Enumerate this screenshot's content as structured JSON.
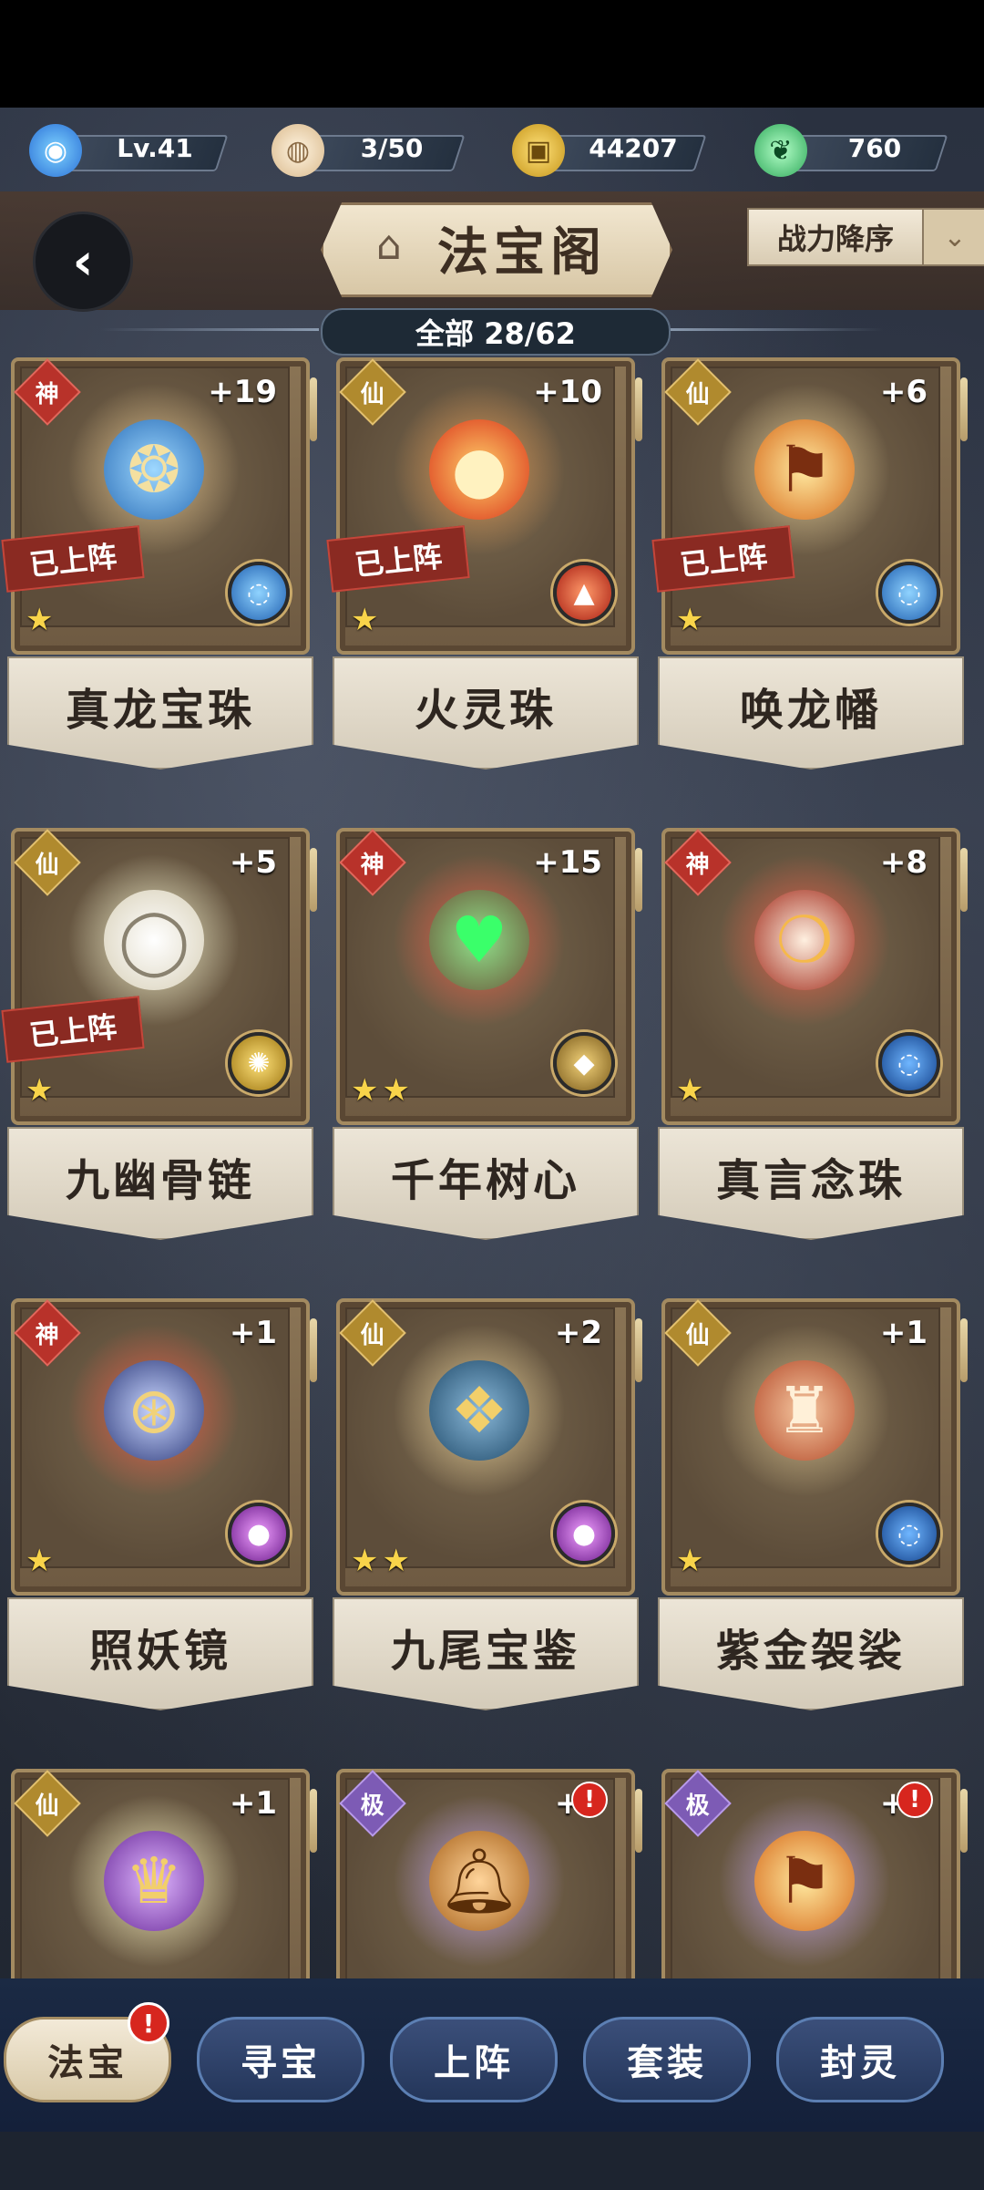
{
  "resources": {
    "level": "Lv.41",
    "stamina": "3/50",
    "coins": "44207",
    "jade": "760"
  },
  "header": {
    "title": "法宝阁",
    "sort_label": "战力降序",
    "count_label": "全部 28/62"
  },
  "cards": [
    {
      "grade": "神",
      "level": "+19",
      "name": "真龙宝珠",
      "deployed": "已上阵",
      "stars": "★"
    },
    {
      "grade": "仙",
      "level": "+10",
      "name": "火灵珠",
      "deployed": "已上阵",
      "stars": "★"
    },
    {
      "grade": "仙",
      "level": "+6",
      "name": "唤龙幡",
      "deployed": "已上阵",
      "stars": "★"
    },
    {
      "grade": "仙",
      "level": "+5",
      "name": "九幽骨链",
      "deployed": "已上阵",
      "stars": "★"
    },
    {
      "grade": "神",
      "level": "+15",
      "name": "千年树心",
      "stars": "★★"
    },
    {
      "grade": "神",
      "level": "+8",
      "name": "真言念珠",
      "stars": "★"
    },
    {
      "grade": "神",
      "level": "+1",
      "name": "照妖镜",
      "stars": "★"
    },
    {
      "grade": "仙",
      "level": "+2",
      "name": "九尾宝鉴",
      "stars": "★★"
    },
    {
      "grade": "仙",
      "level": "+1",
      "name": "紫金袈裟",
      "stars": "★"
    },
    {
      "grade": "仙",
      "level": "+1"
    },
    {
      "grade": "极",
      "level": "+3",
      "badge": "!"
    },
    {
      "grade": "极",
      "level": "+3",
      "badge": "!"
    }
  ],
  "tabs": [
    {
      "label": "法宝",
      "badge": "!"
    },
    {
      "label": "寻宝"
    },
    {
      "label": "上阵"
    },
    {
      "label": "套装"
    },
    {
      "label": "封灵"
    }
  ],
  "colors": {
    "grade_shen": "#c0392b",
    "grade_xian": "#b08a2e",
    "grade_ji": "#7d5bb5",
    "deployed_tag": "#8a2a22",
    "star": "#f8d44a"
  }
}
